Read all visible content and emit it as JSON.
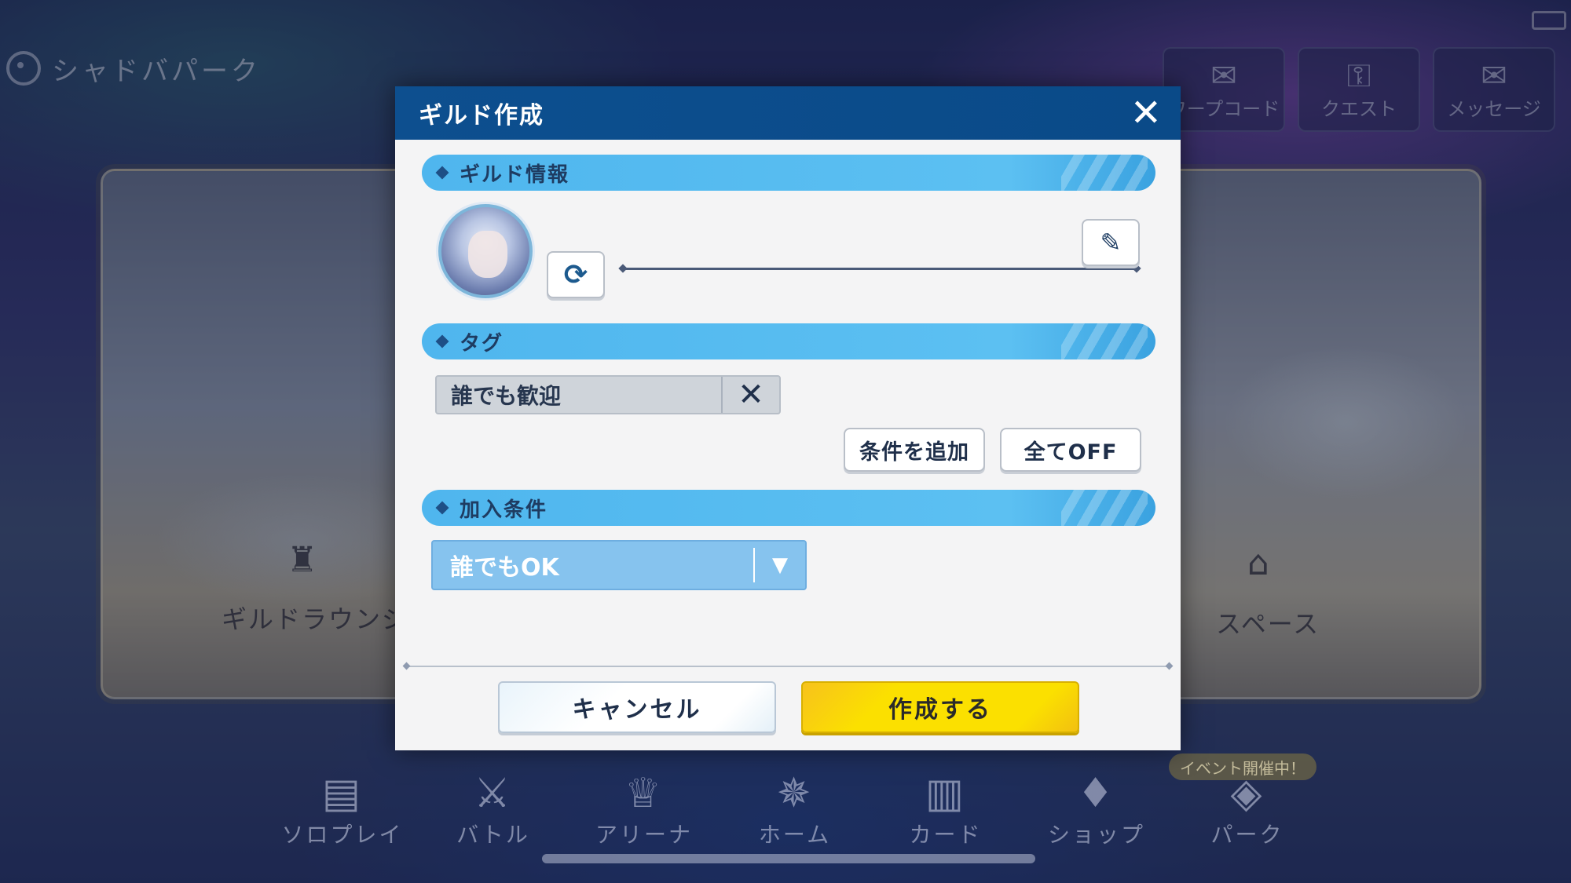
{
  "screen": {
    "park_title": "シャドバパーク",
    "top_buttons": [
      {
        "label": "ワープコード",
        "icon": "map-pin-mail-icon"
      },
      {
        "label": "クエスト",
        "icon": "quest-scroll-icon"
      },
      {
        "label": "メッセージ",
        "icon": "message-user-icon"
      }
    ],
    "areas": {
      "guild_lounge": "ギルドラウンジ",
      "space": "スペース"
    },
    "bottom_nav": [
      {
        "label": "ソロプレイ",
        "icon": "solo-play-icon"
      },
      {
        "label": "バトル",
        "icon": "crossed-swords-icon"
      },
      {
        "label": "アリーナ",
        "icon": "trophy-icon"
      },
      {
        "label": "ホーム",
        "icon": "compass-icon"
      },
      {
        "label": "カード",
        "icon": "cards-icon"
      },
      {
        "label": "ショップ",
        "icon": "shop-icon"
      },
      {
        "label": "パーク",
        "icon": "park-icon"
      }
    ],
    "event_badge": "イベント開催中！"
  },
  "dialog": {
    "title": "ギルド作成",
    "sections": {
      "guild_info": "ギルド情報",
      "tags": "タグ",
      "join_conditions": "加入条件"
    },
    "tag_chip": "誰でも歓迎",
    "add_condition_button": "条件を追加",
    "all_off_button": "全てOFF",
    "join_condition_value": "誰でもOK",
    "cancel_button": "キャンセル",
    "create_button": "作成する"
  },
  "colors": {
    "header": "#0d4f8f",
    "section_bar": "#5cc0f2",
    "create_button": "#fbe000",
    "select_bg": "#86c3ee"
  }
}
